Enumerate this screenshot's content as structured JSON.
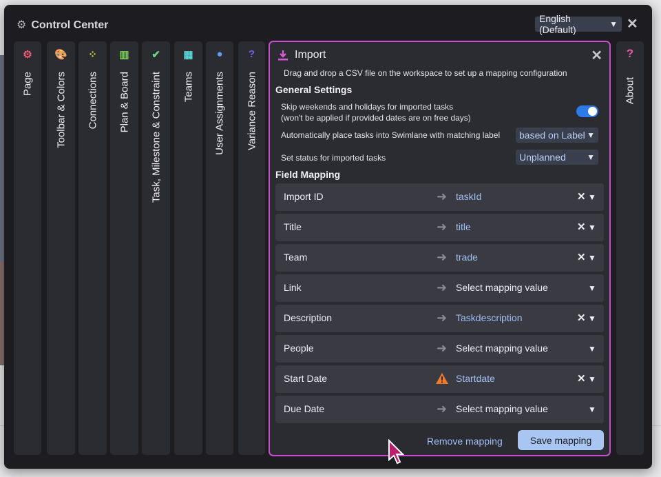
{
  "window": {
    "title": "Control Center",
    "language": "English (Default)"
  },
  "tabs": [
    {
      "label": "Page",
      "icon": "gears-icon",
      "color": "#e85a73"
    },
    {
      "label": "Toolbar & Colors",
      "icon": "palette-icon",
      "color": "#f29d3a"
    },
    {
      "label": "Connections",
      "icon": "connections-icon",
      "color": "#d8e33a"
    },
    {
      "label": "Plan & Board",
      "icon": "board-icon",
      "color": "#7ad05a"
    },
    {
      "label": "Task, Milestone & Constraint",
      "icon": "task-check-icon",
      "color": "#6fd98b"
    },
    {
      "label": "Teams",
      "icon": "building-icon",
      "color": "#5ad6d6"
    },
    {
      "label": "User Assignments",
      "icon": "user-icon",
      "color": "#5a9df2"
    },
    {
      "label": "Variance Reason",
      "icon": "question-icon",
      "color": "#7a5ee8"
    }
  ],
  "about": {
    "label": "About",
    "icon": "question-icon",
    "color": "#e85aa8"
  },
  "import": {
    "title": "Import",
    "description": "Drag and drop a CSV file on the workspace to set up a mapping configuration",
    "general_settings_title": "General Settings",
    "skip_weekends_line1": "Skip weekends and holidays for imported tasks",
    "skip_weekends_line2": "(won't be applied if provided dates are on free days)",
    "skip_weekends_enabled": true,
    "swimlane_label": "Automatically place tasks into Swimlane with matching label",
    "swimlane_value": "based on Label",
    "status_label": "Set status for imported tasks",
    "status_value": "Unplanned",
    "field_mapping_title": "Field Mapping",
    "mappings": [
      {
        "field": "Import ID",
        "value": "taskId",
        "mapped": true
      },
      {
        "field": "Title",
        "value": "title",
        "mapped": true
      },
      {
        "field": "Team",
        "value": "trade",
        "mapped": true
      },
      {
        "field": "Link",
        "value": "Select mapping value",
        "mapped": false
      },
      {
        "field": "Description",
        "value": "Taskdescription",
        "mapped": true
      },
      {
        "field": "People",
        "value": "Select mapping value",
        "mapped": false
      },
      {
        "field": "Start Date",
        "value": "Startdate",
        "mapped": true,
        "warning": true
      },
      {
        "field": "Due Date",
        "value": "Select mapping value",
        "mapped": false
      }
    ],
    "remove_label": "Remove mapping",
    "save_label": "Save mapping"
  }
}
